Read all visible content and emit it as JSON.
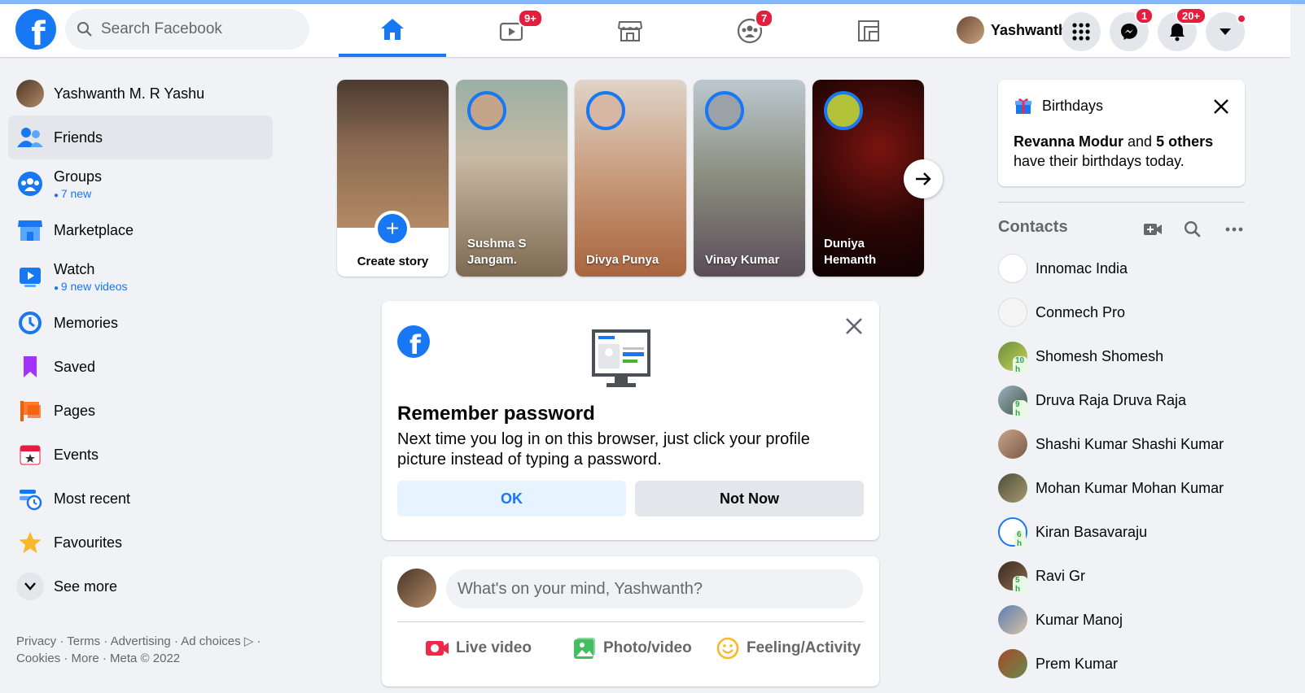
{
  "header": {
    "search_placeholder": "Search Facebook",
    "nav_badges": {
      "watch": "9+",
      "groups": "7"
    },
    "profile_name": "Yashwanth",
    "messenger_badge": "1",
    "notifications_badge": "20+"
  },
  "sidebar": {
    "profile": "Yashwanth M. R Yashu",
    "items": [
      {
        "label": "Friends"
      },
      {
        "label": "Groups",
        "sub": "7 new"
      },
      {
        "label": "Marketplace"
      },
      {
        "label": "Watch",
        "sub": "9 new videos"
      },
      {
        "label": "Memories"
      },
      {
        "label": "Saved"
      },
      {
        "label": "Pages"
      },
      {
        "label": "Events"
      },
      {
        "label": "Most recent"
      },
      {
        "label": "Favourites"
      },
      {
        "label": "See more"
      }
    ],
    "footer": "Privacy · Terms · Advertising · Ad choices ▷ · Cookies · More · Meta © 2022"
  },
  "stories": {
    "create_label": "Create story",
    "items": [
      {
        "name": "Sushma S Jangam."
      },
      {
        "name": "Divya Punya"
      },
      {
        "name": "Vinay Kumar"
      },
      {
        "name": "Duniya Hemanth"
      }
    ]
  },
  "remember": {
    "title": "Remember password",
    "body": "Next time you log in on this browser, just click your profile picture instead of typing a password.",
    "ok_label": "OK",
    "not_now_label": "Not Now"
  },
  "composer": {
    "placeholder": "What's on your mind, Yashwanth?",
    "live_label": "Live video",
    "photo_label": "Photo/video",
    "feeling_label": "Feeling/Activity"
  },
  "birthdays": {
    "title": "Birthdays",
    "name": "Revanna Modur",
    "and": " and ",
    "others": "5 others",
    "rest": "have their birthdays today."
  },
  "contacts": {
    "title": "Contacts",
    "items": [
      {
        "name": "Innomac India",
        "time": ""
      },
      {
        "name": "Conmech Pro",
        "time": ""
      },
      {
        "name": "Shomesh Shomesh",
        "time": "10 h"
      },
      {
        "name": "Druva Raja Druva Raja",
        "time": "9 h"
      },
      {
        "name": "Shashi Kumar Shashi Kumar",
        "time": ""
      },
      {
        "name": "Mohan Kumar Mohan Kumar",
        "time": ""
      },
      {
        "name": "Kiran Basavaraju",
        "time": "6 h"
      },
      {
        "name": "Ravi Gr",
        "time": "5 h"
      },
      {
        "name": "Kumar Manoj",
        "time": ""
      },
      {
        "name": "Prem Kumar",
        "time": ""
      }
    ]
  },
  "colors": {
    "accent": "#1877f2",
    "badge": "#e41e3f",
    "background": "#f0f2f5"
  }
}
